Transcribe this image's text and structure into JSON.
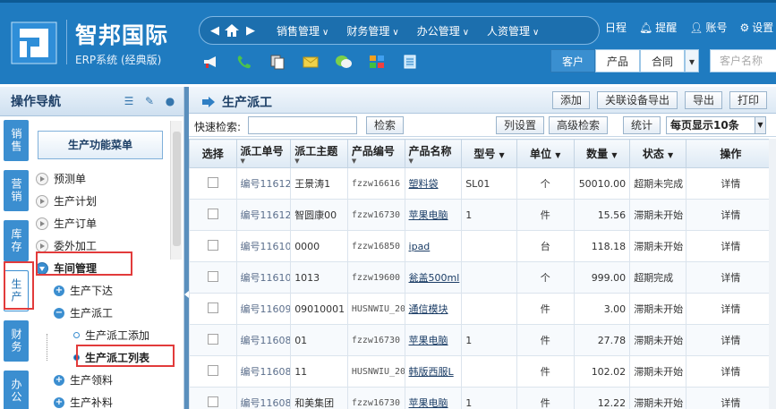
{
  "header": {
    "brand": "智邦国际",
    "subtitle": "ERP系统 (经典版)",
    "nav": [
      {
        "label": "销售管理"
      },
      {
        "label": "财务管理"
      },
      {
        "label": "办公管理"
      },
      {
        "label": "人资管理"
      }
    ],
    "top_links": [
      {
        "icon": "calendar-icon",
        "label": "日程"
      },
      {
        "icon": "bell-icon",
        "label": "提醒"
      },
      {
        "icon": "user-icon",
        "label": "账号"
      },
      {
        "icon": "gear-icon",
        "label": "设置"
      }
    ],
    "scope_tabs": [
      {
        "label": "客户",
        "active": true
      },
      {
        "label": "产品",
        "active": false
      },
      {
        "label": "合同",
        "active": false
      }
    ],
    "search_placeholder": "客户名称",
    "toolbar_icons": [
      "megaphone-icon",
      "phone-icon",
      "copy-icon",
      "mail-icon",
      "chat-icon",
      "grid-icon",
      "document-icon"
    ]
  },
  "sidebar": {
    "title": "操作导航",
    "vtabs": [
      {
        "label": "销售"
      },
      {
        "label": "营销"
      },
      {
        "label": "库存"
      },
      {
        "label": "生产",
        "active": true
      },
      {
        "label": "财务"
      },
      {
        "label": "办公"
      }
    ],
    "menu_header": "生产功能菜单",
    "tree": [
      {
        "label": "预测单"
      },
      {
        "label": "生产计划"
      },
      {
        "label": "生产订单"
      },
      {
        "label": "委外加工"
      },
      {
        "label": "车间管理"
      },
      {
        "label": "生产下达"
      },
      {
        "label": "生产派工"
      },
      {
        "label": "生产派工添加"
      },
      {
        "label": "生产派工列表"
      },
      {
        "label": "生产领料"
      },
      {
        "label": "生产补料"
      }
    ]
  },
  "main": {
    "title": "生产派工",
    "actions": [
      "添加",
      "关联设备导出",
      "导出",
      "打印"
    ],
    "search_label": "快速检索:",
    "search_button": "检索",
    "filter_buttons": [
      "列设置",
      "高级检索",
      "统计"
    ],
    "page_size": "每页显示10条",
    "columns": [
      "选择",
      "派工单号",
      "派工主题",
      "产品编号",
      "产品名称",
      "型号",
      "单位",
      "数量",
      "状态",
      "操作"
    ],
    "rows": [
      [
        "",
        "编号11612",
        "王景涛1",
        "fzzw16616",
        "塑料袋",
        "SL01",
        "个",
        "50010.00",
        "超期未完成",
        "详情"
      ],
      [
        "",
        "编号11612",
        "智圆康00",
        "fzzw16730",
        "苹果电脑",
        "1",
        "件",
        "15.56",
        "滞期未开始",
        "详情"
      ],
      [
        "",
        "编号11610",
        "0000",
        "fzzw16850",
        "ipad",
        "",
        "台",
        "118.18",
        "滞期未开始",
        "详情"
      ],
      [
        "",
        "编号11610",
        "1013",
        "fzzw19600",
        "瓮盖500ml",
        "",
        "个",
        "999.00",
        "超期完成",
        "详情"
      ],
      [
        "",
        "编号11609",
        "09010001",
        "HUSNWIU_20",
        "通信模块",
        "",
        "件",
        "3.00",
        "滞期未开始",
        "详情"
      ],
      [
        "",
        "编号11608",
        "01",
        "fzzw16730",
        "苹果电脑",
        "1",
        "件",
        "27.78",
        "滞期未开始",
        "详情"
      ],
      [
        "",
        "编号11608",
        "11",
        "HUSNWIU_20",
        "韩版西服L",
        "",
        "件",
        "102.02",
        "滞期未开始",
        "详情"
      ],
      [
        "",
        "编号11608",
        "和美集团",
        "fzzw16730",
        "苹果电脑",
        "1",
        "件",
        "12.22",
        "滞期未开始",
        "详情"
      ]
    ]
  }
}
